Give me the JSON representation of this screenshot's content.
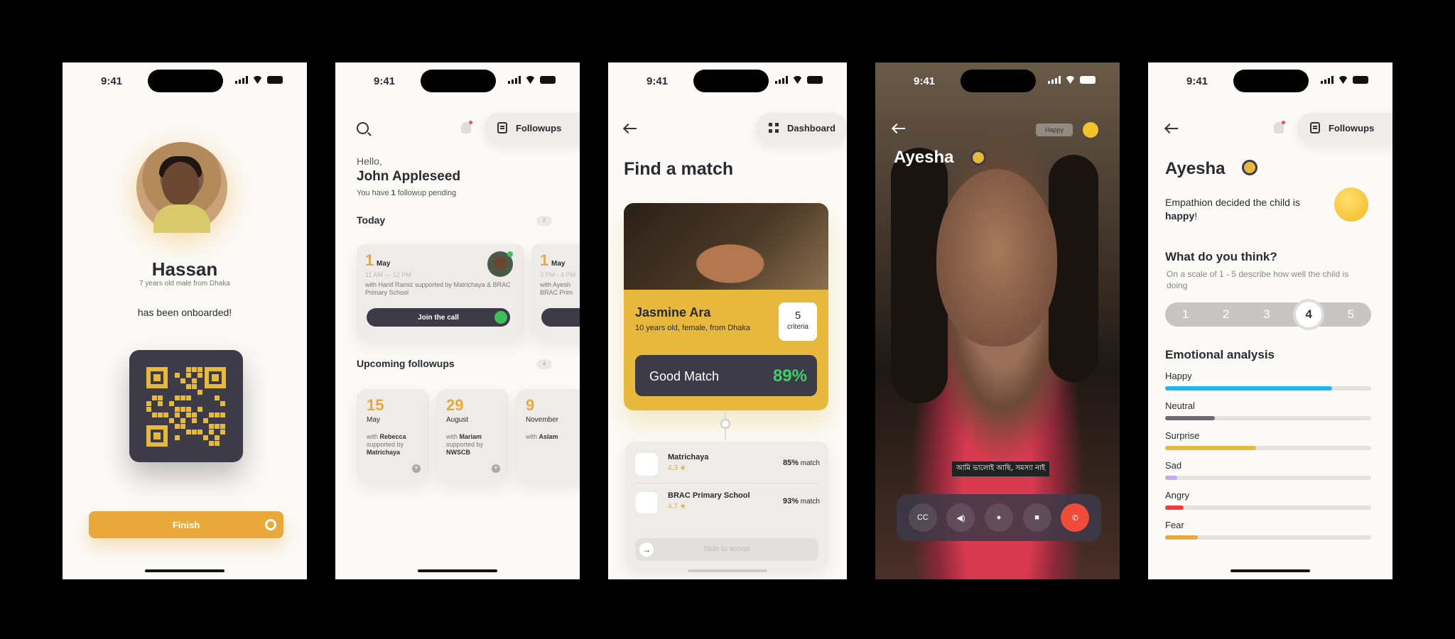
{
  "status_time": "9:41",
  "screen1": {
    "name": "Hassan",
    "subtitle": "7 years old male from Dhaka",
    "message": "has been onboarded!",
    "finish_label": "Finish"
  },
  "screen2": {
    "greeting": "Hello,",
    "user_name": "John Appleseed",
    "pending_pre": "You have ",
    "pending_count": "1",
    "pending_post": " followup pending",
    "followups_label": "Followups",
    "today_label": "Today",
    "today_count": "2",
    "today_cards": [
      {
        "day": "1",
        "month": "May",
        "time": "11 AM — 12 PM",
        "with": "with Hanif Ramiz supported by Matrichaya & BRAC Primary School",
        "action": "Join the call"
      },
      {
        "day": "1",
        "month": "May",
        "time": "3 PM - 4 PM",
        "with": "with Ayesh BRAC Prim"
      }
    ],
    "upcoming_label": "Upcoming followups",
    "upcoming_count": "4",
    "upcoming": [
      {
        "day": "15",
        "month": "May",
        "pre": "with ",
        "name": "Rebecca",
        "mid": " supported by ",
        "org": "Matrichaya"
      },
      {
        "day": "29",
        "month": "August",
        "pre": "with ",
        "name": "Mariam",
        "mid": " supported by ",
        "org": "NWSCB"
      },
      {
        "day": "9",
        "month": "November",
        "pre": "with ",
        "name": "Aslam",
        "mid": "",
        "org": ""
      }
    ]
  },
  "screen3": {
    "dashboard_label": "Dashboard",
    "title": "Find a match",
    "match_name": "Jasmine Ara",
    "match_sub": "10 years old, female, from Dhaka",
    "criteria_num": "5",
    "criteria_label": "criteria",
    "good_label": "Good Match",
    "good_pct": "89%",
    "orgs": [
      {
        "name": "Matrichaya",
        "rating": "4.3",
        "pct": "85%",
        "suffix": " match"
      },
      {
        "name": "BRAC Primary School",
        "rating": "4.7",
        "pct": "93%",
        "suffix": " match"
      }
    ],
    "accept_label": "Slide to accept",
    "star": "★"
  },
  "screen4": {
    "emotion_label": "Happy",
    "name": "Ayesha",
    "caption": "আমি ভালোই আছি, সমস্যা নাই",
    "cc_label": "CC"
  },
  "screen5": {
    "followups_label": "Followups",
    "name": "Ayesha",
    "decision_pre": "Empathion decided the child is ",
    "decision_emotion": "happy",
    "decision_post": "!",
    "question": "What do you think?",
    "question_sub": "On a scale of 1 - 5 describe  how well the child is doing",
    "scale": [
      "1",
      "2",
      "3",
      "4",
      "5"
    ],
    "selected": "4",
    "analysis_title": "Emotional analysis",
    "emotions": [
      {
        "label": "Happy",
        "value": 0.81,
        "color": "#1fb5f0"
      },
      {
        "label": "Neutral",
        "value": 0.24,
        "color": "#6b6a74"
      },
      {
        "label": "Surprise",
        "value": 0.44,
        "color": "#e6b83c"
      },
      {
        "label": "Sad",
        "value": 0.06,
        "color": "#c9a6f0"
      },
      {
        "label": "Angry",
        "value": 0.09,
        "color": "#ef3b3b"
      },
      {
        "label": "Fear",
        "value": 0.16,
        "color": "#e9a93a"
      }
    ]
  }
}
